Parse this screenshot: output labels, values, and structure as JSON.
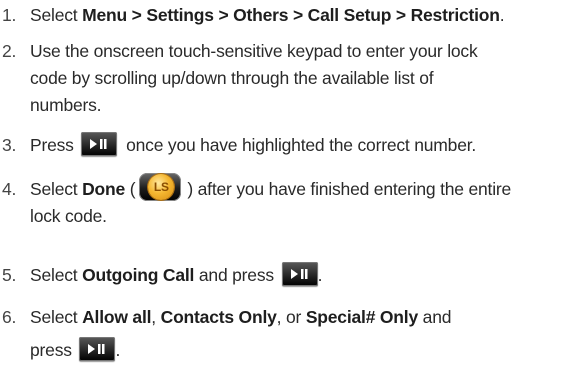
{
  "steps": [
    {
      "number": "1.",
      "pre": "Select ",
      "bold": "Menu > Settings > Others > Call Setup > Restriction",
      "post": "."
    },
    {
      "number": "2.",
      "lines": [
        "Use the onscreen touch-sensitive keypad to enter your lock",
        "code by scrolling up/down through the available list of",
        "numbers."
      ]
    },
    {
      "number": "3.",
      "pre": "Press",
      "post": "once you have highlighted the correct number."
    },
    {
      "number": "4.",
      "pre": "Select ",
      "bold": "Done",
      "mid": " (",
      "post": ") after you have finished entering the entire",
      "line2": "lock code."
    },
    {
      "number": "5.",
      "pre": "Select ",
      "bold": "Outgoing Call",
      "post": " and press",
      "end": "."
    },
    {
      "number": "6.",
      "pre": "Select ",
      "bold1": "Allow all",
      "sep1": ", ",
      "bold2": "Contacts Only",
      "sep2": ", or ",
      "bold3": "Special# Only",
      "post": " and",
      "line2": "press",
      "end": "."
    }
  ],
  "icons": {
    "play_pause": "play-pause-key-icon",
    "ls": "ls-softkey-icon",
    "ls_label": "LS"
  }
}
